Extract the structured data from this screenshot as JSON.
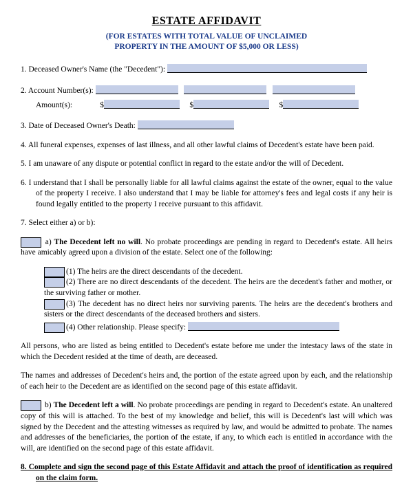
{
  "title": "ESTATE AFFIDAVIT",
  "subtitle_line1": "(FOR ESTATES WITH TOTAL VALUE OF UNCLAIMED",
  "subtitle_line2": "PROPERTY IN THE AMOUNT OF $5,000 OR LESS)",
  "items": {
    "n1_label": "1.   Deceased Owner's Name (the \"Decedent\"): ",
    "n2_label": "2.   Account Number(s): ",
    "n2_amount_label": "Amount(s):",
    "n2_dollar": "$",
    "n3_label": "3.   Date of Deceased Owner's Death: ",
    "n4": "4.   All funeral expenses, expenses of last illness, and all other lawful claims of Decedent's estate have been paid.",
    "n5": "5.   I am unaware of any dispute or potential conflict in regard to the estate and/or the will of Decedent.",
    "n6": "6.   I understand that I shall be personally liable for all lawful claims against the estate of the owner, equal to the value of the property I receive.  I also understand that I may be liable for attorney's fees and legal costs if any heir is found legally entitled to the property I receive pursuant to this affidavit.",
    "n7": "7.   Select either a) or b):"
  },
  "optA": {
    "label": " a)  ",
    "bold": "The Decedent left no will",
    "rest": ".  No probate proceedings are pending in regard to Decedent's estate.  All heirs have amicably agreed upon a division of the estate.  Select one of the following:"
  },
  "subopts": {
    "s1": "(1) The heirs are the direct descendants of the decedent.",
    "s2": "(2) There are no direct descendants of the decedent.  The heirs are the decedent's father and mother, or the surviving father or mother.",
    "s3": "(3) The decedent has no direct heirs nor surviving parents.  The heirs are the decedent's brothers and sisters or the direct descendants of the deceased brothers and sisters.",
    "s4": "(4) Other relationship.  Please specify: "
  },
  "para1": "All persons, who are listed as being entitled to Decedent's estate before me under the intestacy laws of the state in which the Decedent resided at the time of death, are deceased.",
  "para2": "The names and addresses of Decedent's heirs and, the portion of the estate agreed upon by each, and the relationship of each heir to the Decedent are as identified on the second page of this estate affidavit.",
  "optB": {
    "label": " b)  ",
    "bold": "The Decedent left a will",
    "rest": ".  No probate proceedings are pending in regard to Decedent's estate.  An unaltered copy of this will is attached.  To the best of my knowledge and belief, this will is Decedent's last will which was signed by the Decedent and the attesting witnesses as required by law, and would be admitted to probate.  The names and addresses of the beneficiaries, the portion of the estate, if any, to which each is entitled in accordance with the  will, are identified on the second page of this estate affidavit."
  },
  "n8": "8.  Complete and sign the second page of this Estate Affidavit and attach the proof of identification as required on the claim form."
}
